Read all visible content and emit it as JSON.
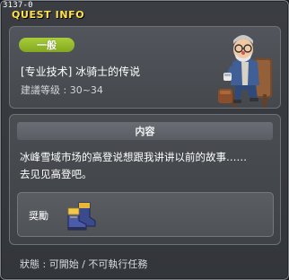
{
  "window": {
    "quest_id": "3137-0",
    "title": "QUEST INFO"
  },
  "quest": {
    "category": "一般",
    "name": "[专业技术] 冰骑士的传说",
    "level_requirement": "建議等级 : 30~34",
    "npc_icon": "old-man-npc-icon"
  },
  "content": {
    "header": "内容",
    "line1": "冰峰雪域市场的高登说想跟我讲讲以前的故事……",
    "line2": "去见见高登吧。"
  },
  "reward": {
    "label": "奨勵",
    "item_icon": "boots-icon"
  },
  "status": {
    "text": "狀態 : 可開始 / 不可執行任務"
  },
  "colors": {
    "title": "#ffe14a",
    "badge": "#9bbf2e",
    "panel": "#4a4d52"
  }
}
